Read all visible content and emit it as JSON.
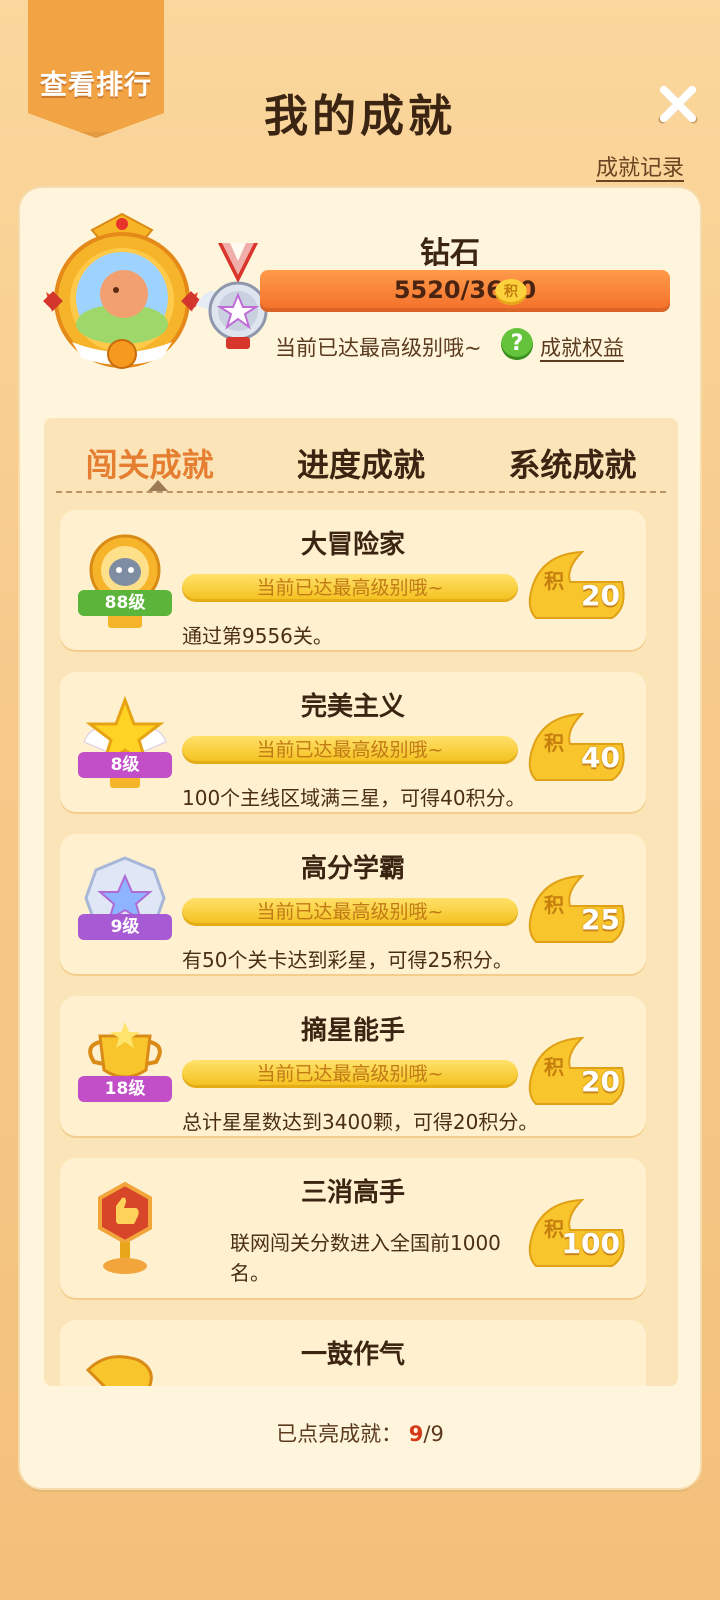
{
  "header": {
    "rank_button": "查看排行",
    "title": "我的成就",
    "record_link": "成就记录"
  },
  "summary": {
    "rank_name": "钻石",
    "points_progress": "5520/3600",
    "coin_glyph": "积",
    "max_level_text": "当前已达最高级别哦~",
    "benefits_link": "成就权益",
    "help_glyph": "?"
  },
  "tabs": [
    {
      "label": "闯关成就",
      "active": true
    },
    {
      "label": "进度成就",
      "active": false
    },
    {
      "label": "系统成就",
      "active": false
    }
  ],
  "achievements": [
    {
      "title": "大冒险家",
      "level": "88级",
      "status": "当前已达最高级别哦~",
      "desc": "通过第9556关。",
      "points": "20",
      "ribbon_color": "#5bb53a"
    },
    {
      "title": "完美主义",
      "level": "8级",
      "status": "当前已达最高级别哦~",
      "desc": "100个主线区域满三星，可得40积分。",
      "points": "40",
      "ribbon_color": "#c24fc7"
    },
    {
      "title": "高分学霸",
      "level": "9级",
      "status": "当前已达最高级别哦~",
      "desc": "有50个关卡达到彩星，可得25积分。",
      "points": "25",
      "ribbon_color": "#a85ad4"
    },
    {
      "title": "摘星能手",
      "level": "18级",
      "status": "当前已达最高级别哦~",
      "desc": "总计星星数达到3400颗，可得20积分。",
      "points": "20",
      "ribbon_color": "#c24fc7"
    },
    {
      "title": "三消高手",
      "level": "",
      "status": "",
      "desc": "联网闯关分数进入全国前1000名。",
      "points": "100",
      "ribbon_color": ""
    },
    {
      "title": "一鼓作气",
      "level": "",
      "status": "",
      "desc": "",
      "points": "",
      "ribbon_color": ""
    }
  ],
  "footer": {
    "label": "已点亮成就：",
    "lit": "9",
    "sep": "/",
    "total": "9"
  },
  "colors": {
    "accent": "#e67e31",
    "progress": "#f36e2a",
    "highlight": "#d43a18"
  }
}
